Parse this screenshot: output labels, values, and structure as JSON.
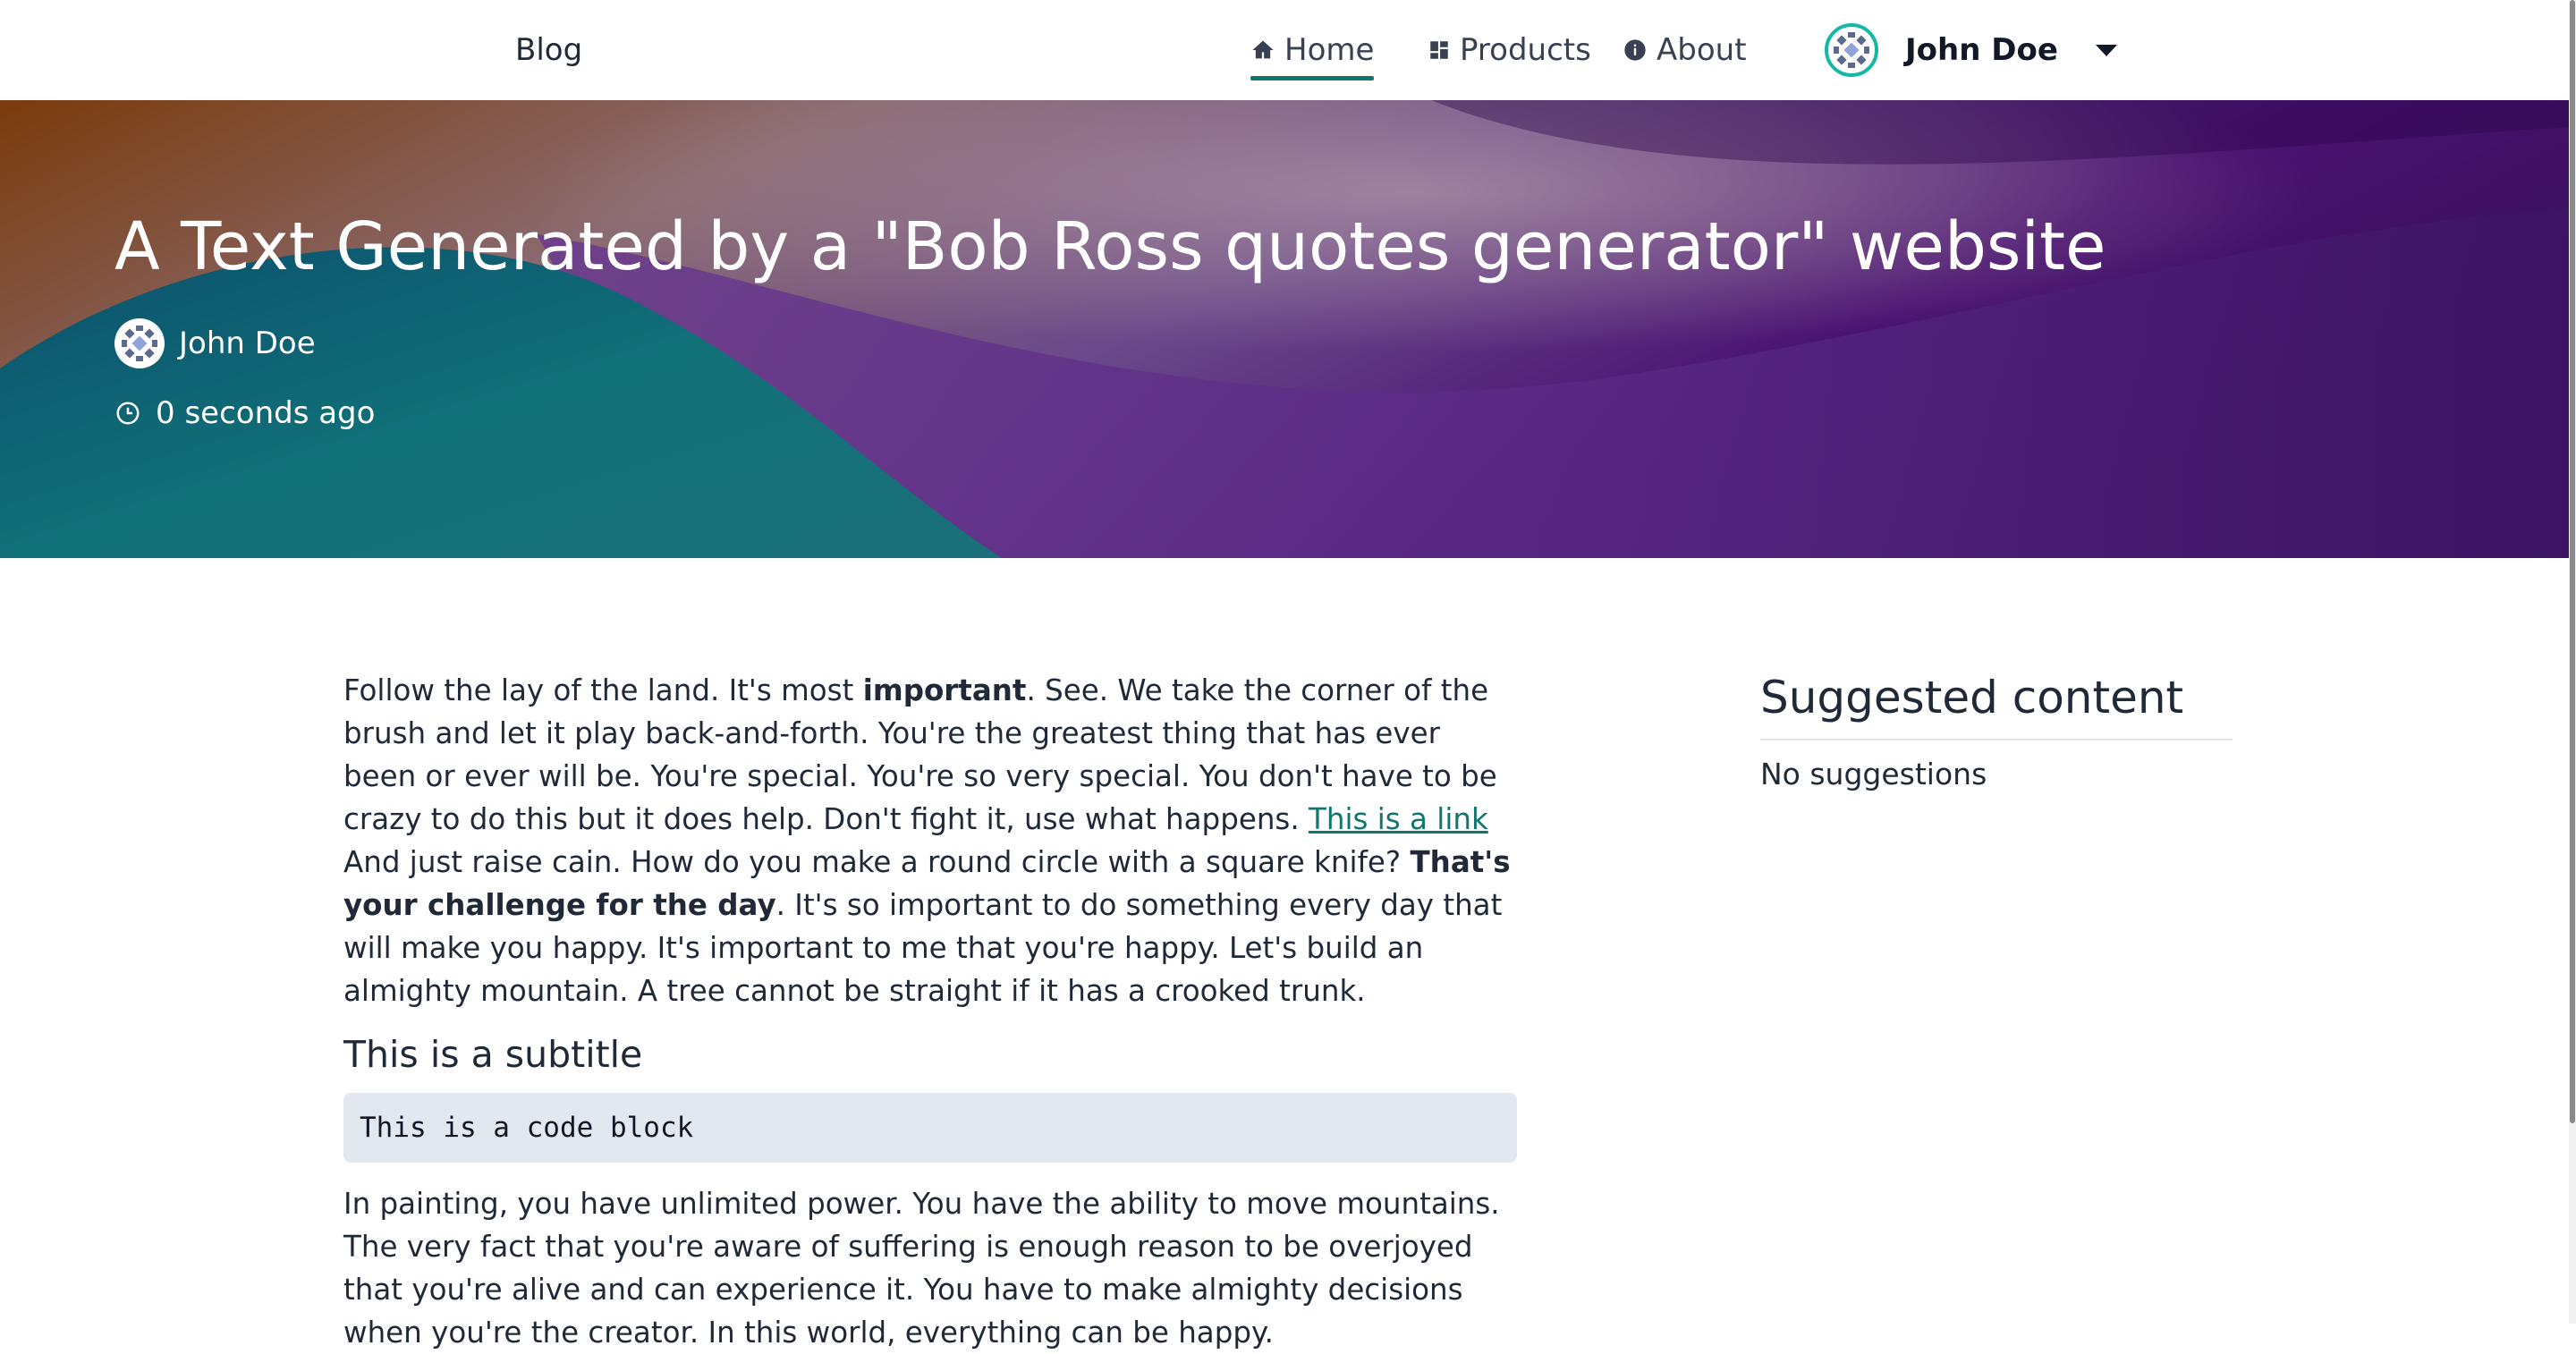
{
  "navbar": {
    "brand": "Blog",
    "items": [
      {
        "label": "Home",
        "icon": "home-icon",
        "active": true
      },
      {
        "label": "Products",
        "icon": "dashboard-icon",
        "active": false
      },
      {
        "label": "About",
        "icon": "info-icon",
        "active": false
      }
    ],
    "user": {
      "name": "John Doe",
      "icon": "chevron-down-icon"
    }
  },
  "hero": {
    "title": "A Text Generated by a \"Bob Ross quotes generator\" website",
    "author": "John Doe",
    "time": "0 seconds ago"
  },
  "article": {
    "p1": {
      "t1": "Follow the lay of the land. It's most ",
      "b1": "important",
      "t2": ". See. We take the corner of the brush and let it play back-and-forth. You're the greatest thing that has ever been or ever will be. You're special. You're so very special. You don't have to be crazy to do this but it does help. Don't fight it, use what happens. ",
      "link": "This is a link",
      "t3": " And just raise cain. How do you make a round circle with a square knife? ",
      "b2": "That's your challenge for the day",
      "t4": ". It's so important to do something every day that will make you happy. It's important to me that you're happy. Let's build an almighty mountain. A tree cannot be straight if it has a crooked trunk."
    },
    "subtitle": "This is a subtitle",
    "code": "This is a code block",
    "p2": "In painting, you have unlimited power. You have the ability to move mountains. The very fact that you're aware of suffering is enough reason to be overjoyed that you're alive and can experience it. You have to make almighty decisions when you're the creator. In this world, everything can be happy."
  },
  "aside": {
    "title": "Suggested content",
    "empty": "No suggestions"
  },
  "colors": {
    "accent": "#0f766e",
    "code_bg": "#e2e8f0",
    "hero_purple": "#3a0f5c",
    "hero_orange": "#7a3b0c",
    "hero_teal": "#0d5c73"
  }
}
